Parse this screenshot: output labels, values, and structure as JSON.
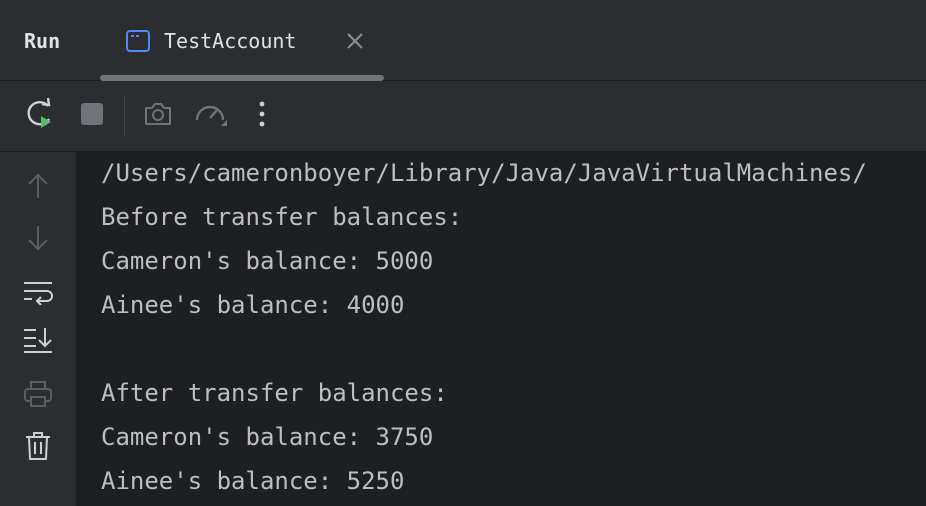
{
  "tool_window": {
    "title": "Run"
  },
  "tab": {
    "label": "TestAccount",
    "icon": "console-window-icon"
  },
  "toolbar": {
    "buttons": [
      {
        "name": "rerun-icon",
        "enabled": true
      },
      {
        "name": "stop-icon",
        "enabled": false
      },
      {
        "name": "camera-icon",
        "enabled": false
      },
      {
        "name": "profiler-icon",
        "enabled": false
      },
      {
        "name": "more-options-icon",
        "enabled": true
      }
    ]
  },
  "gutter": {
    "buttons": [
      {
        "name": "up-arrow-icon",
        "enabled": false
      },
      {
        "name": "down-arrow-icon",
        "enabled": false
      },
      {
        "name": "soft-wrap-icon",
        "enabled": true
      },
      {
        "name": "scroll-to-end-icon",
        "enabled": true
      },
      {
        "name": "print-icon",
        "enabled": false
      },
      {
        "name": "trash-icon",
        "enabled": true
      }
    ]
  },
  "console": {
    "lines": [
      "/Users/cameronboyer/Library/Java/JavaVirtualMachines/",
      "Before transfer balances:",
      "Cameron's balance: 5000",
      "Ainee's balance: 4000",
      "",
      "After transfer balances:",
      "Cameron's balance: 3750",
      "Ainee's balance: 5250"
    ]
  },
  "colors": {
    "background": "#1e1f22",
    "panel": "#2b2d30",
    "text": "#bcbec4",
    "title_text": "#dfe1e5",
    "icon_active": "#ced0d6",
    "icon_disabled": "#6f737a",
    "run_green": "#5fb865",
    "tab_icon_blue": "#548af7"
  }
}
